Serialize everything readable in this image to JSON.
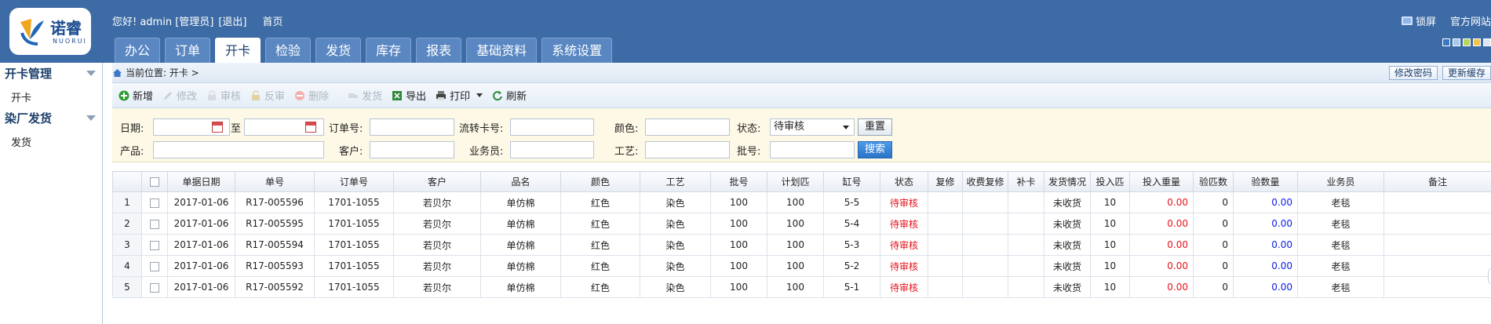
{
  "logo": {
    "name": "诺睿",
    "sub": "NUORUI"
  },
  "topbar": {
    "greeting": "您好! admin [管理员]",
    "logout": "[退出]",
    "home": "首页"
  },
  "topright": {
    "lock": "锁屏",
    "site": "官方网站"
  },
  "swatch_colors": [
    "#3b78c4",
    "#a7c8ea",
    "#b6d65c",
    "#f0c54a",
    "#dde7f2"
  ],
  "nav": {
    "tabs": [
      "办公",
      "订单",
      "开卡",
      "检验",
      "发货",
      "库存",
      "报表",
      "基础资料",
      "系统设置"
    ],
    "active": "开卡"
  },
  "sidebar": {
    "groups": [
      {
        "title": "开卡管理",
        "items": [
          "开卡"
        ]
      },
      {
        "title": "染厂发货",
        "items": [
          "发货"
        ]
      }
    ]
  },
  "breadcrumb": {
    "text": "当前位置: 开卡 >"
  },
  "crumb_actions": {
    "change_password": "修改密码",
    "refresh_cache": "更新缓存"
  },
  "toolbar": {
    "add": "新增",
    "edit": "修改",
    "audit": "审核",
    "unaudit": "反审",
    "delete": "删除",
    "ship": "发货",
    "export": "导出",
    "print": "打印",
    "refresh": "刷新"
  },
  "filter": {
    "date_label": "日期:",
    "to_label": "至",
    "order_label": "订单号:",
    "card_label": "流转卡号:",
    "color_label": "颜色:",
    "status_label": "状态:",
    "status_value": "待审核",
    "reset": "重置",
    "product_label": "产品:",
    "customer_label": "客户:",
    "sales_label": "业务员:",
    "craft_label": "工艺:",
    "batch_label": "批号:",
    "search": "搜索"
  },
  "table": {
    "headers": [
      "单据日期",
      "单号",
      "订单号",
      "客户",
      "品名",
      "颜色",
      "工艺",
      "批号",
      "计划匹",
      "缸号",
      "状态",
      "复修",
      "收费复修",
      "补卡",
      "发货情况",
      "投入匹",
      "投入重量",
      "验匹数",
      "验数量",
      "业务员",
      "备注"
    ],
    "rows": [
      {
        "n": "1",
        "date": "2017-01-06",
        "no": "R17-005596",
        "order": "1701-1055",
        "customer": "若贝尔",
        "product": "单仿棉",
        "color": "红色",
        "craft": "染色",
        "batch": "100",
        "plan": "100",
        "vat": "5-5",
        "status": "待审核",
        "repair": "",
        "charge": "",
        "supp": "",
        "ship": "未收货",
        "inpcs": "10",
        "inwt": "0.00",
        "chkpcs": "0",
        "chkqty": "0.00",
        "sales": "老毯",
        "remark": ""
      },
      {
        "n": "2",
        "date": "2017-01-06",
        "no": "R17-005595",
        "order": "1701-1055",
        "customer": "若贝尔",
        "product": "单仿棉",
        "color": "红色",
        "craft": "染色",
        "batch": "100",
        "plan": "100",
        "vat": "5-4",
        "status": "待审核",
        "repair": "",
        "charge": "",
        "supp": "",
        "ship": "未收货",
        "inpcs": "10",
        "inwt": "0.00",
        "chkpcs": "0",
        "chkqty": "0.00",
        "sales": "老毯",
        "remark": ""
      },
      {
        "n": "3",
        "date": "2017-01-06",
        "no": "R17-005594",
        "order": "1701-1055",
        "customer": "若贝尔",
        "product": "单仿棉",
        "color": "红色",
        "craft": "染色",
        "batch": "100",
        "plan": "100",
        "vat": "5-3",
        "status": "待审核",
        "repair": "",
        "charge": "",
        "supp": "",
        "ship": "未收货",
        "inpcs": "10",
        "inwt": "0.00",
        "chkpcs": "0",
        "chkqty": "0.00",
        "sales": "老毯",
        "remark": ""
      },
      {
        "n": "4",
        "date": "2017-01-06",
        "no": "R17-005593",
        "order": "1701-1055",
        "customer": "若贝尔",
        "product": "单仿棉",
        "color": "红色",
        "craft": "染色",
        "batch": "100",
        "plan": "100",
        "vat": "5-2",
        "status": "待审核",
        "repair": "",
        "charge": "",
        "supp": "",
        "ship": "未收货",
        "inpcs": "10",
        "inwt": "0.00",
        "chkpcs": "0",
        "chkqty": "0.00",
        "sales": "老毯",
        "remark": ""
      },
      {
        "n": "5",
        "date": "2017-01-06",
        "no": "R17-005592",
        "order": "1701-1055",
        "customer": "若贝尔",
        "product": "单仿棉",
        "color": "红色",
        "craft": "染色",
        "batch": "100",
        "plan": "100",
        "vat": "5-1",
        "status": "待审核",
        "repair": "",
        "charge": "",
        "supp": "",
        "ship": "未收货",
        "inpcs": "10",
        "inwt": "0.00",
        "chkpcs": "0",
        "chkqty": "0.00",
        "sales": "老毯",
        "remark": ""
      }
    ]
  }
}
